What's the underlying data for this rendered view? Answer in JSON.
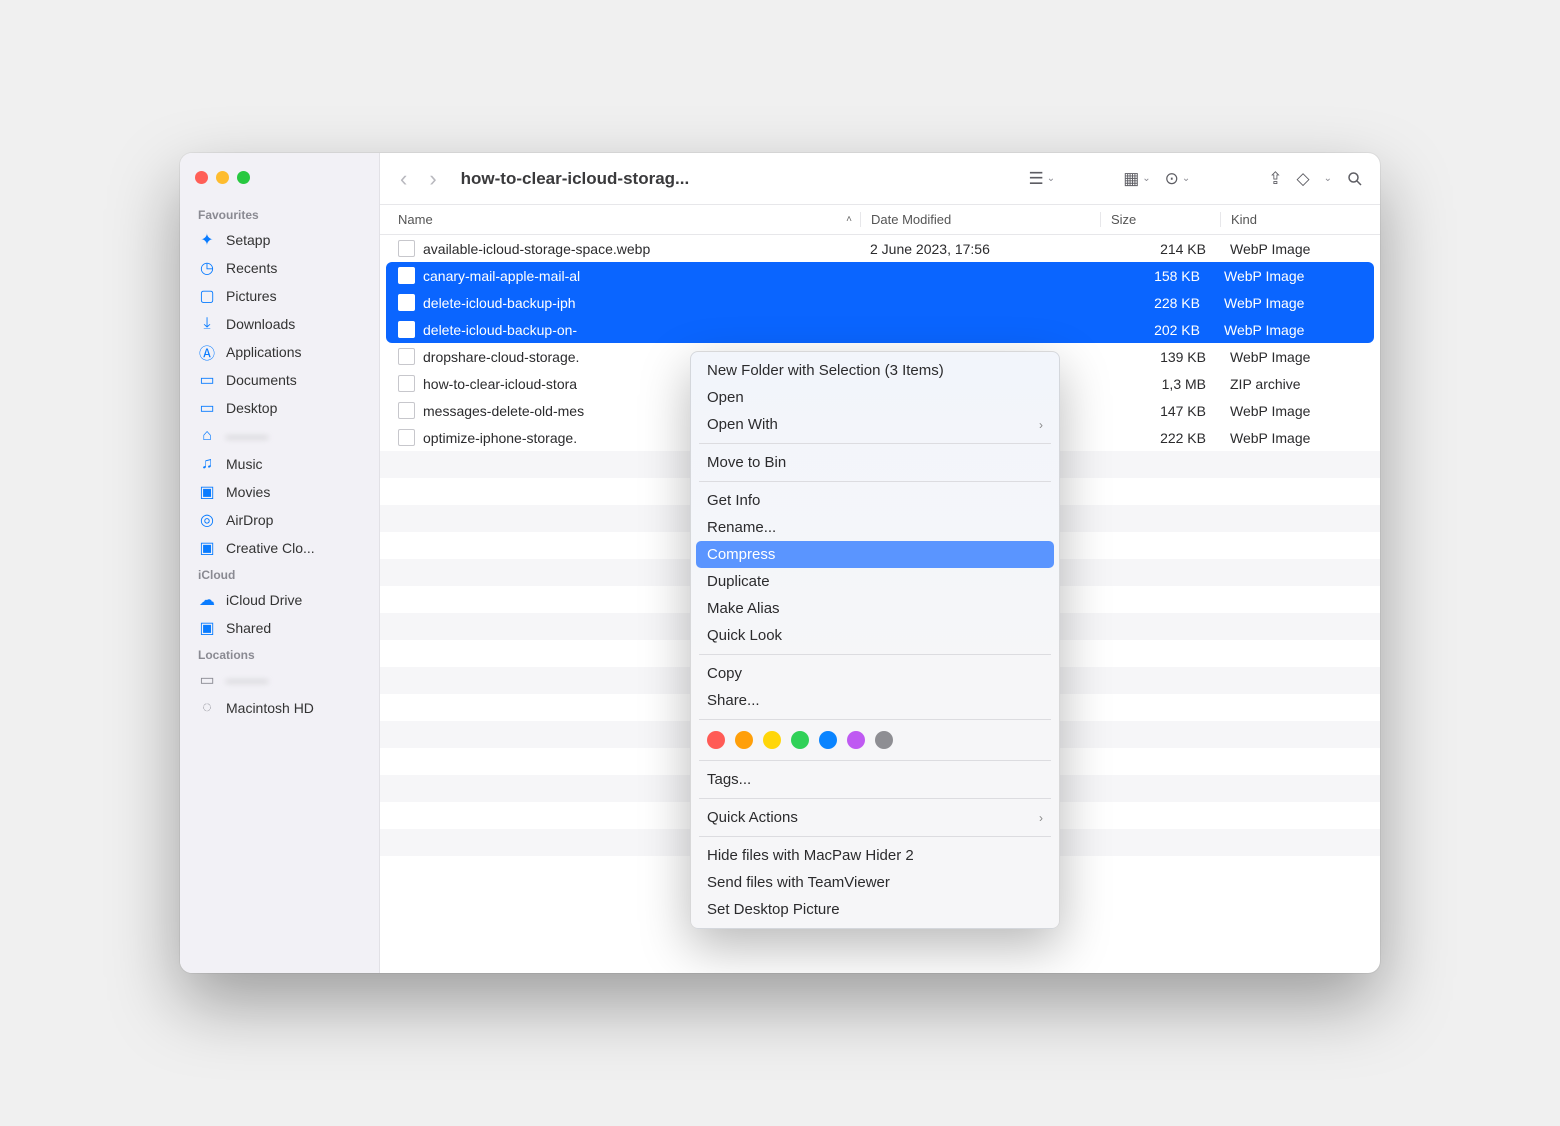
{
  "window": {
    "title": "how-to-clear-icloud-storag..."
  },
  "sidebar": {
    "sections": [
      {
        "label": "Favourites",
        "items": [
          {
            "icon": "setapp",
            "label": "Setapp"
          },
          {
            "icon": "clock",
            "label": "Recents"
          },
          {
            "icon": "image",
            "label": "Pictures"
          },
          {
            "icon": "download",
            "label": "Downloads"
          },
          {
            "icon": "apps",
            "label": "Applications"
          },
          {
            "icon": "doc",
            "label": "Documents"
          },
          {
            "icon": "desktop",
            "label": "Desktop"
          },
          {
            "icon": "home",
            "label": "",
            "blurred": true
          },
          {
            "icon": "music",
            "label": "Music"
          },
          {
            "icon": "movie",
            "label": "Movies"
          },
          {
            "icon": "airdrop",
            "label": "AirDrop"
          },
          {
            "icon": "folder",
            "label": "Creative Clo..."
          }
        ]
      },
      {
        "label": "iCloud",
        "items": [
          {
            "icon": "cloud",
            "label": "iCloud Drive"
          },
          {
            "icon": "shared",
            "label": "Shared"
          }
        ]
      },
      {
        "label": "Locations",
        "items": [
          {
            "icon": "laptop",
            "label": "",
            "blurred": true,
            "gray": true
          },
          {
            "icon": "disk",
            "label": "Macintosh HD",
            "gray": true
          }
        ]
      }
    ]
  },
  "columns": {
    "name": "Name",
    "date": "Date Modified",
    "size": "Size",
    "kind": "Kind"
  },
  "files": [
    {
      "name": "available-icloud-storage-space.webp",
      "date": "2 June 2023, 17:56",
      "size": "214 KB",
      "kind": "WebP Image",
      "sel": false
    },
    {
      "name": "canary-mail-apple-mail-al",
      "date": "",
      "size": "158 KB",
      "kind": "WebP Image",
      "sel": true
    },
    {
      "name": "delete-icloud-backup-iph",
      "date": "",
      "size": "228 KB",
      "kind": "WebP Image",
      "sel": true
    },
    {
      "name": "delete-icloud-backup-on-",
      "date": "",
      "size": "202 KB",
      "kind": "WebP Image",
      "sel": true
    },
    {
      "name": "dropshare-cloud-storage.",
      "date": "",
      "size": "139 KB",
      "kind": "WebP Image",
      "sel": false
    },
    {
      "name": "how-to-clear-icloud-stora",
      "date": "",
      "size": "1,3 MB",
      "kind": "ZIP archive",
      "sel": false
    },
    {
      "name": "messages-delete-old-mes",
      "date": "",
      "size": "147 KB",
      "kind": "WebP Image",
      "sel": false
    },
    {
      "name": "optimize-iphone-storage.",
      "date": "",
      "size": "222 KB",
      "kind": "WebP Image",
      "sel": false
    }
  ],
  "menu": {
    "groups": [
      [
        {
          "label": "New Folder with Selection (3 Items)"
        },
        {
          "label": "Open"
        },
        {
          "label": "Open With",
          "sub": true
        }
      ],
      [
        {
          "label": "Move to Bin"
        }
      ],
      [
        {
          "label": "Get Info"
        },
        {
          "label": "Rename..."
        },
        {
          "label": "Compress",
          "highlight": true
        },
        {
          "label": "Duplicate"
        },
        {
          "label": "Make Alias"
        },
        {
          "label": "Quick Look"
        }
      ],
      [
        {
          "label": "Copy"
        },
        {
          "label": "Share..."
        }
      ],
      "tags",
      [
        {
          "label": "Tags..."
        }
      ],
      [
        {
          "label": "Quick Actions",
          "sub": true
        }
      ],
      [
        {
          "label": "Hide files with MacPaw Hider 2"
        },
        {
          "label": "Send files with TeamViewer"
        },
        {
          "label": "Set Desktop Picture"
        }
      ]
    ],
    "tagColors": [
      "#ff5b56",
      "#ff9f0a",
      "#ffd60a",
      "#30d158",
      "#0a84ff",
      "#bf5af2",
      "#8e8e93"
    ]
  }
}
